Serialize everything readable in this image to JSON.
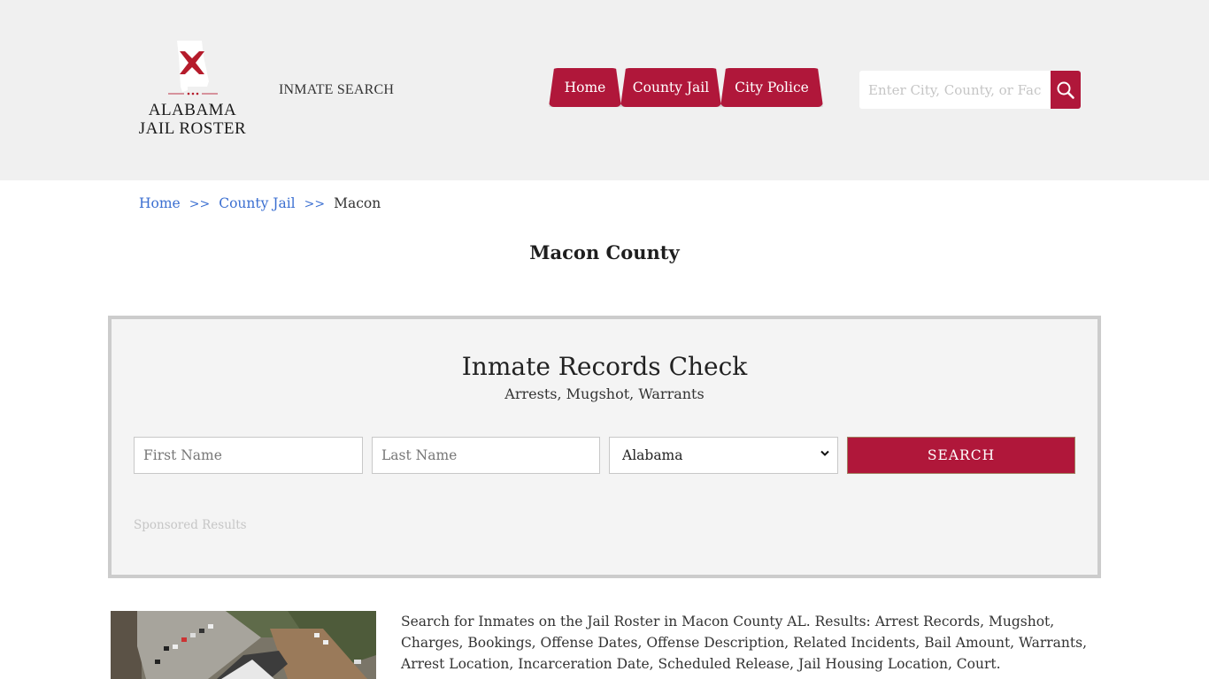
{
  "header": {
    "logo": {
      "line1": "ALABAMA",
      "line2": "JAIL ROSTER",
      "icon": "alabama-state-flag-icon"
    },
    "inmate_search_link": "INMATE SEARCH",
    "nav": [
      {
        "label": "Home"
      },
      {
        "label": "County Jail"
      },
      {
        "label": "City Police"
      }
    ],
    "search": {
      "placeholder": "Enter City, County, or Facility",
      "value": "",
      "icon": "search-icon"
    }
  },
  "breadcrumb": {
    "items": [
      {
        "label": "Home"
      },
      {
        "label": "County Jail"
      }
    ],
    "separator": ">>",
    "current": "Macon"
  },
  "page_title": "Macon County",
  "records_check": {
    "title": "Inmate Records Check",
    "subtitle": "Arrests, Mugshot, Warrants",
    "first_name": {
      "placeholder": "First Name",
      "value": ""
    },
    "last_name": {
      "placeholder": "Last Name",
      "value": ""
    },
    "state_select": {
      "selected": "Alabama"
    },
    "submit_label": "SEARCH",
    "sponsored_label": "Sponsored Results"
  },
  "content": {
    "image": "aerial-jail-photo",
    "description": "Search for Inmates on the Jail Roster in Macon County AL. Results: Arrest Records, Mugshot, Charges, Bookings, Offense Dates, Offense Description, Related Incidents, Bail Amount, Warrants, Arrest Location, Incarceration Date, Scheduled Release, Jail Housing Location, Court."
  },
  "colors": {
    "brand_red": "#b0173a",
    "header_bg": "#f0f0f0",
    "link_blue": "#3b6fd1",
    "box_bg": "#f4f4f4",
    "box_border": "#cccccc"
  }
}
